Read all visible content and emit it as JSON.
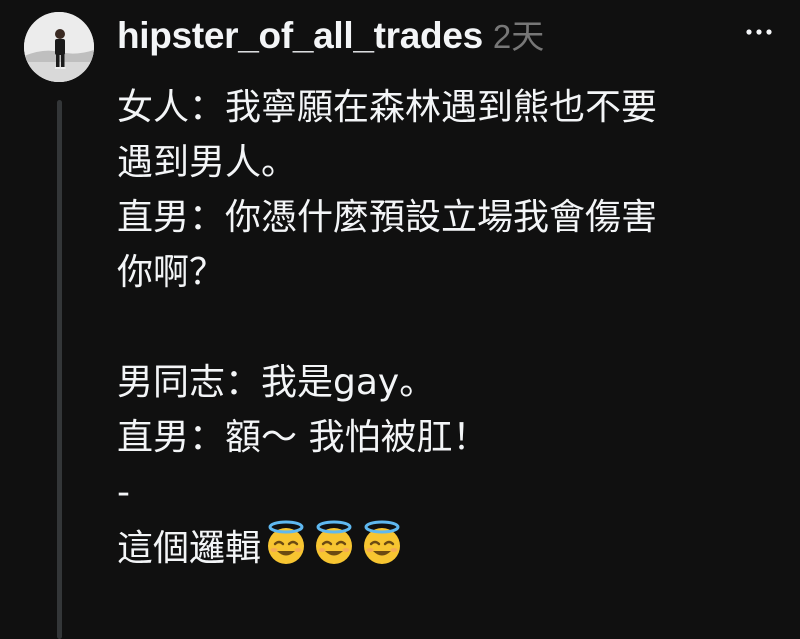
{
  "comment": {
    "username": "hipster_of_all_trades",
    "timestamp": "2天",
    "lines": [
      "女人：我寧願在森林遇到熊也不要",
      "遇到男人。",
      "直男：你憑什麼預設立場我會傷害",
      "你啊？",
      "",
      "男同志：我是gay。",
      "直男：額～ 我怕被肛！",
      "-",
      "這個邏輯"
    ],
    "trailing_emoji": [
      "smiling-face-with-halo",
      "smiling-face-with-halo",
      "smiling-face-with-halo"
    ]
  },
  "icons": {
    "more": "more-horizontal-icon"
  },
  "colors": {
    "background": "#101010",
    "text": "#f3f5f7",
    "muted": "#777777",
    "thread_line": "#333638"
  }
}
